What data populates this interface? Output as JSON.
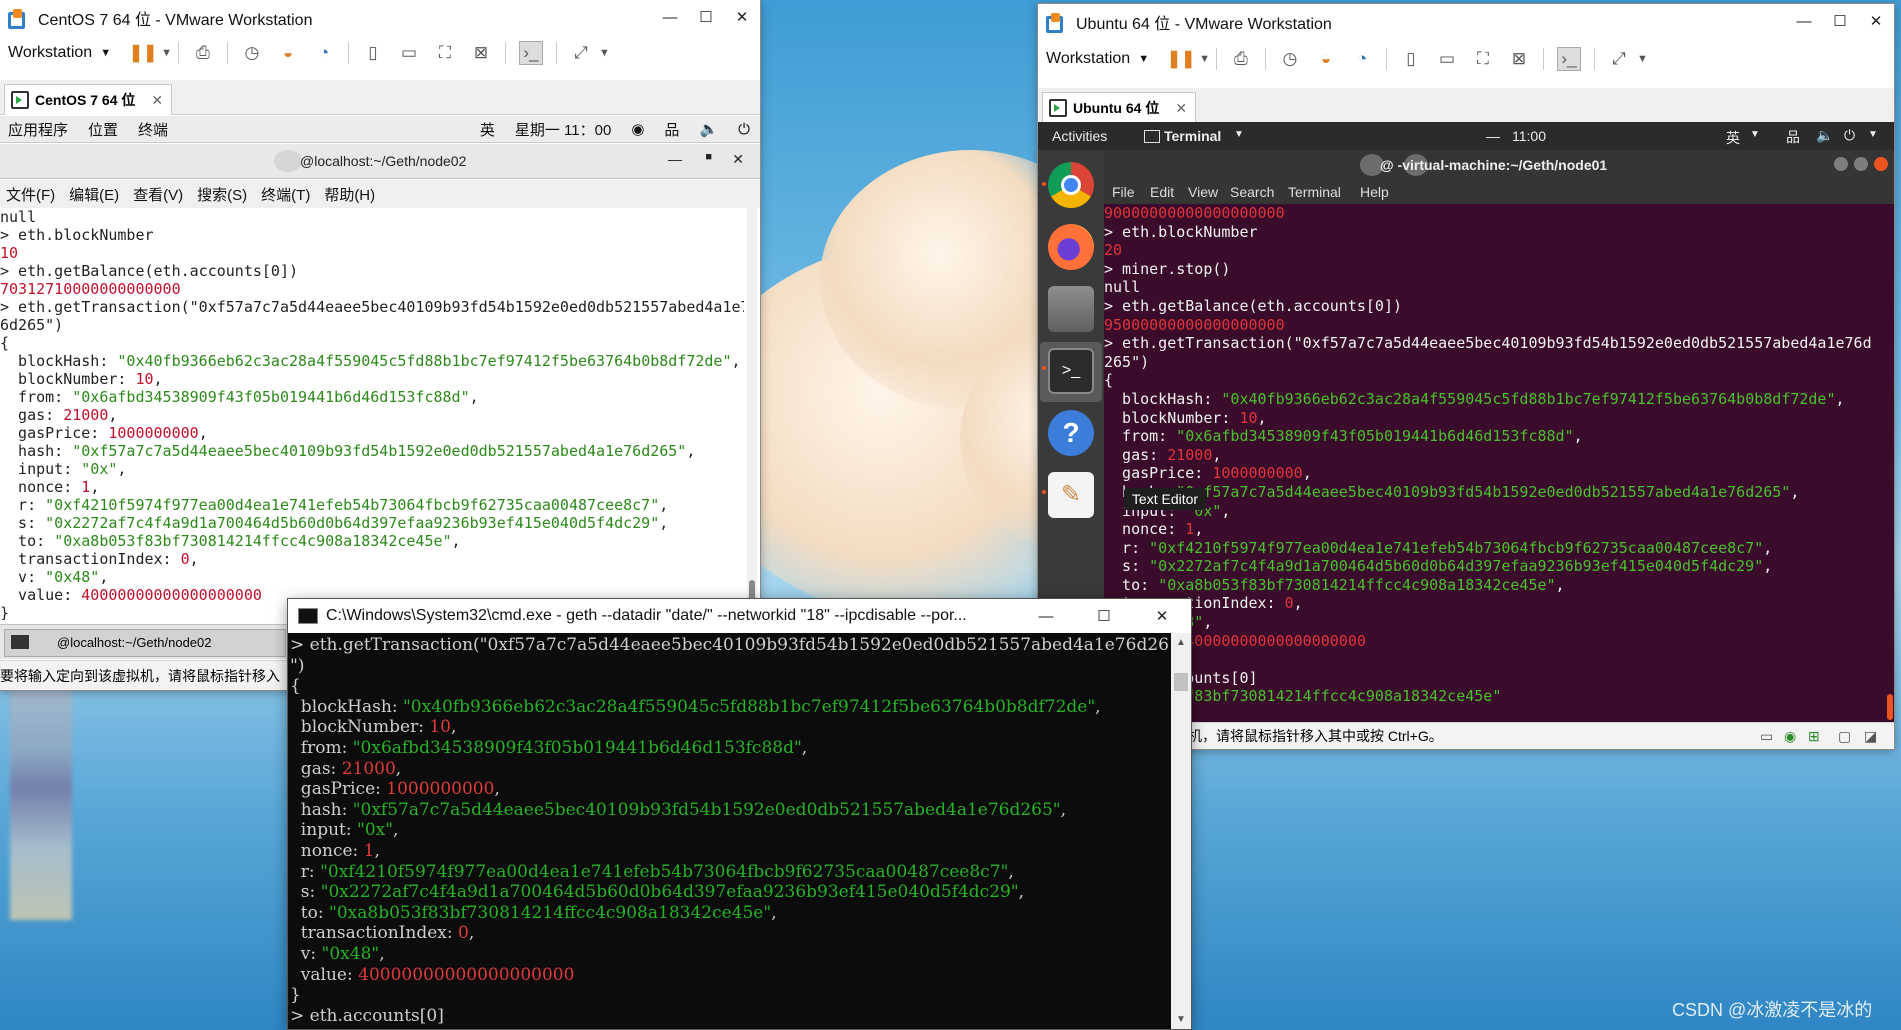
{
  "centos": {
    "window_title": "CentOS 7 64 位 - VMware Workstation",
    "toolbar_label": "Workstation",
    "tab_label": "CentOS 7 64 位",
    "gnome": {
      "apps": "应用程序",
      "places": "位置",
      "terminal": "终端",
      "ime": "英",
      "clock": "星期一 11：00"
    },
    "term_title": "@localhost:~/Geth/node02",
    "menu": [
      "文件(F)",
      "编辑(E)",
      "查看(V)",
      "搜索(S)",
      "终端(T)",
      "帮助(H)"
    ],
    "taskbar_item": "@localhost:~/Geth/node02",
    "status": "要将输入定向到该虚拟机，请将鼠标指针移入",
    "console": [
      [
        [
          "t",
          "null"
        ]
      ],
      [
        [
          "t",
          "> eth.blockNumber"
        ]
      ],
      [
        [
          "n",
          "10"
        ]
      ],
      [
        [
          "t",
          "> eth.getBalance(eth.accounts[0])"
        ]
      ],
      [
        [
          "n",
          "70312710000000000000"
        ]
      ],
      [
        [
          "t",
          "> eth.getTransaction(\"0xf57a7c7a5d44eaee5bec40109b93fd54b1592e0ed0db521557abed4a1e7"
        ]
      ],
      [
        [
          "t",
          "6d265\")"
        ]
      ],
      [
        [
          "t",
          "{"
        ]
      ],
      [
        [
          "t",
          "  blockHash: "
        ],
        [
          "s",
          "\"0x40fb9366eb62c3ac28a4f559045c5fd88b1bc7ef97412f5be63764b0b8df72de\""
        ],
        [
          "t",
          ","
        ]
      ],
      [
        [
          "t",
          "  blockNumber: "
        ],
        [
          "n",
          "10"
        ],
        [
          "t",
          ","
        ]
      ],
      [
        [
          "t",
          "  from: "
        ],
        [
          "s",
          "\"0x6afbd34538909f43f05b019441b6d46d153fc88d\""
        ],
        [
          "t",
          ","
        ]
      ],
      [
        [
          "t",
          "  gas: "
        ],
        [
          "n",
          "21000"
        ],
        [
          "t",
          ","
        ]
      ],
      [
        [
          "t",
          "  gasPrice: "
        ],
        [
          "n",
          "1000000000"
        ],
        [
          "t",
          ","
        ]
      ],
      [
        [
          "t",
          "  hash: "
        ],
        [
          "s",
          "\"0xf57a7c7a5d44eaee5bec40109b93fd54b1592e0ed0db521557abed4a1e76d265\""
        ],
        [
          "t",
          ","
        ]
      ],
      [
        [
          "t",
          "  input: "
        ],
        [
          "s",
          "\"0x\""
        ],
        [
          "t",
          ","
        ]
      ],
      [
        [
          "t",
          "  nonce: "
        ],
        [
          "n",
          "1"
        ],
        [
          "t",
          ","
        ]
      ],
      [
        [
          "t",
          "  r: "
        ],
        [
          "s",
          "\"0xf4210f5974f977ea00d4ea1e741efeb54b73064fbcb9f62735caa00487cee8c7\""
        ],
        [
          "t",
          ","
        ]
      ],
      [
        [
          "t",
          "  s: "
        ],
        [
          "s",
          "\"0x2272af7c4f4a9d1a700464d5b60d0b64d397efaa9236b93ef415e040d5f4dc29\""
        ],
        [
          "t",
          ","
        ]
      ],
      [
        [
          "t",
          "  to: "
        ],
        [
          "s",
          "\"0xa8b053f83bf730814214ffcc4c908a18342ce45e\""
        ],
        [
          "t",
          ","
        ]
      ],
      [
        [
          "t",
          "  transactionIndex: "
        ],
        [
          "n",
          "0"
        ],
        [
          "t",
          ","
        ]
      ],
      [
        [
          "t",
          "  v: "
        ],
        [
          "s",
          "\"0x48\""
        ],
        [
          "t",
          ","
        ]
      ],
      [
        [
          "t",
          "  value: "
        ],
        [
          "n",
          "40000000000000000000"
        ]
      ],
      [
        [
          "t",
          "}"
        ]
      ],
      [
        [
          "t",
          "> "
        ]
      ]
    ]
  },
  "ubuntu": {
    "window_title": "Ubuntu 64 位 - VMware Workstation",
    "toolbar_label": "Workstation",
    "tab_label": "Ubuntu 64 位",
    "topbar": {
      "activities": "Activities",
      "app": "Terminal",
      "clock": "11:00",
      "ime": "英"
    },
    "term_title": "@        -virtual-machine:~/Geth/node01",
    "menu": [
      "File",
      "Edit",
      "View",
      "Search",
      "Terminal",
      "Help"
    ],
    "tooltip": "Text Editor",
    "status": "机，请将鼠标指针移入其中或按 Ctrl+G。",
    "console": [
      [
        [
          "n",
          "90000000000000000000"
        ]
      ],
      [
        [
          "t",
          "> eth.blockNumber"
        ]
      ],
      [
        [
          "n",
          "20"
        ]
      ],
      [
        [
          "t",
          "> miner.stop()"
        ]
      ],
      [
        [
          "t",
          "null"
        ]
      ],
      [
        [
          "t",
          "> eth.getBalance(eth.accounts[0])"
        ]
      ],
      [
        [
          "n",
          "95000000000000000000"
        ]
      ],
      [
        [
          "t",
          "> eth.getTransaction(\"0xf57a7c7a5d44eaee5bec40109b93fd54b1592e0ed0db521557abed4a1e76d"
        ]
      ],
      [
        [
          "t",
          "265\")"
        ]
      ],
      [
        [
          "t",
          "{"
        ]
      ],
      [
        [
          "t",
          "  blockHash: "
        ],
        [
          "s",
          "\"0x40fb9366eb62c3ac28a4f559045c5fd88b1bc7ef97412f5be63764b0b8df72de\""
        ],
        [
          "t",
          ","
        ]
      ],
      [
        [
          "t",
          "  blockNumber: "
        ],
        [
          "n",
          "10"
        ],
        [
          "t",
          ","
        ]
      ],
      [
        [
          "t",
          "  from: "
        ],
        [
          "s",
          "\"0x6afbd34538909f43f05b019441b6d46d153fc88d\""
        ],
        [
          "t",
          ","
        ]
      ],
      [
        [
          "t",
          "  gas: "
        ],
        [
          "n",
          "21000"
        ],
        [
          "t",
          ","
        ]
      ],
      [
        [
          "t",
          "  gasPrice: "
        ],
        [
          "n",
          "1000000000"
        ],
        [
          "t",
          ","
        ]
      ],
      [
        [
          "t",
          "  hash: "
        ],
        [
          "s",
          "\"0xf57a7c7a5d44eaee5bec40109b93fd54b1592e0ed0db521557abed4a1e76d265\""
        ],
        [
          "t",
          ","
        ]
      ],
      [
        [
          "t",
          "  input: "
        ],
        [
          "s",
          "\"0x\""
        ],
        [
          "t",
          ","
        ]
      ],
      [
        [
          "t",
          "  nonce: "
        ],
        [
          "n",
          "1"
        ],
        [
          "t",
          ","
        ]
      ],
      [
        [
          "t",
          "  r: "
        ],
        [
          "s",
          "\"0xf4210f5974f977ea00d4ea1e741efeb54b73064fbcb9f62735caa00487cee8c7\""
        ],
        [
          "t",
          ","
        ]
      ],
      [
        [
          "t",
          "  s: "
        ],
        [
          "s",
          "\"0x2272af7c4f4a9d1a700464d5b60d0b64d397efaa9236b93ef415e040d5f4dc29\""
        ],
        [
          "t",
          ","
        ]
      ],
      [
        [
          "t",
          "  to: "
        ],
        [
          "s",
          "\"0xa8b053f83bf730814214ffcc4c908a18342ce45e\""
        ],
        [
          "t",
          ","
        ]
      ],
      [
        [
          "t",
          "  transactionIndex: "
        ],
        [
          "n",
          "0"
        ],
        [
          "t",
          ","
        ]
      ],
      [
        [
          "t",
          "  v: "
        ],
        [
          "s",
          "\"0x48\""
        ],
        [
          "t",
          ","
        ]
      ],
      [
        [
          "t",
          "  value: "
        ],
        [
          "n",
          "40000000000000000000"
        ]
      ],
      [
        [
          "t",
          "}"
        ]
      ],
      [
        [
          "t",
          "> eth.accounts[0]"
        ]
      ],
      [
        [
          "s",
          "\"0xa8b053f83bf730814214ffcc4c908a18342ce45e\""
        ]
      ]
    ]
  },
  "cmd": {
    "window_title": "C:\\Windows\\System32\\cmd.exe - geth  --datadir  \"date/\"  --networkid \"18\" --ipcdisable --por...",
    "console": [
      [
        [
          "t",
          "> eth.getTransaction(\"0xf57a7c7a5d44eaee5bec40109b93fd54b1592e0ed0db521557abed4a1e76d265"
        ]
      ],
      [
        [
          "t",
          "\")"
        ]
      ],
      [
        [
          "t",
          "{"
        ]
      ],
      [
        [
          "t",
          "  blockHash: "
        ],
        [
          "s",
          "\"0x40fb9366eb62c3ac28a4f559045c5fd88b1bc7ef97412f5be63764b0b8df72de\""
        ],
        [
          "t",
          ","
        ]
      ],
      [
        [
          "t",
          "  blockNumber: "
        ],
        [
          "n",
          "10"
        ],
        [
          "t",
          ","
        ]
      ],
      [
        [
          "t",
          "  from: "
        ],
        [
          "s",
          "\"0x6afbd34538909f43f05b019441b6d46d153fc88d\""
        ],
        [
          "t",
          ","
        ]
      ],
      [
        [
          "t",
          "  gas: "
        ],
        [
          "n",
          "21000"
        ],
        [
          "t",
          ","
        ]
      ],
      [
        [
          "t",
          "  gasPrice: "
        ],
        [
          "n",
          "1000000000"
        ],
        [
          "t",
          ","
        ]
      ],
      [
        [
          "t",
          "  hash: "
        ],
        [
          "s",
          "\"0xf57a7c7a5d44eaee5bec40109b93fd54b1592e0ed0db521557abed4a1e76d265\""
        ],
        [
          "t",
          ","
        ]
      ],
      [
        [
          "t",
          "  input: "
        ],
        [
          "s",
          "\"0x\""
        ],
        [
          "t",
          ","
        ]
      ],
      [
        [
          "t",
          "  nonce: "
        ],
        [
          "n",
          "1"
        ],
        [
          "t",
          ","
        ]
      ],
      [
        [
          "t",
          "  r: "
        ],
        [
          "s",
          "\"0xf4210f5974f977ea00d4ea1e741efeb54b73064fbcb9f62735caa00487cee8c7\""
        ],
        [
          "t",
          ","
        ]
      ],
      [
        [
          "t",
          "  s: "
        ],
        [
          "s",
          "\"0x2272af7c4f4a9d1a700464d5b60d0b64d397efaa9236b93ef415e040d5f4dc29\""
        ],
        [
          "t",
          ","
        ]
      ],
      [
        [
          "t",
          "  to: "
        ],
        [
          "s",
          "\"0xa8b053f83bf730814214ffcc4c908a18342ce45e\""
        ],
        [
          "t",
          ","
        ]
      ],
      [
        [
          "t",
          "  transactionIndex: "
        ],
        [
          "n",
          "0"
        ],
        [
          "t",
          ","
        ]
      ],
      [
        [
          "t",
          "  v: "
        ],
        [
          "s",
          "\"0x48\""
        ],
        [
          "t",
          ","
        ]
      ],
      [
        [
          "t",
          "  value: "
        ],
        [
          "n",
          "40000000000000000000"
        ]
      ],
      [
        [
          "t",
          "}"
        ]
      ],
      [
        [
          "t",
          "> eth.accounts[0]"
        ]
      ]
    ]
  },
  "watermark": "CSDN @冰激凌不是冰的"
}
